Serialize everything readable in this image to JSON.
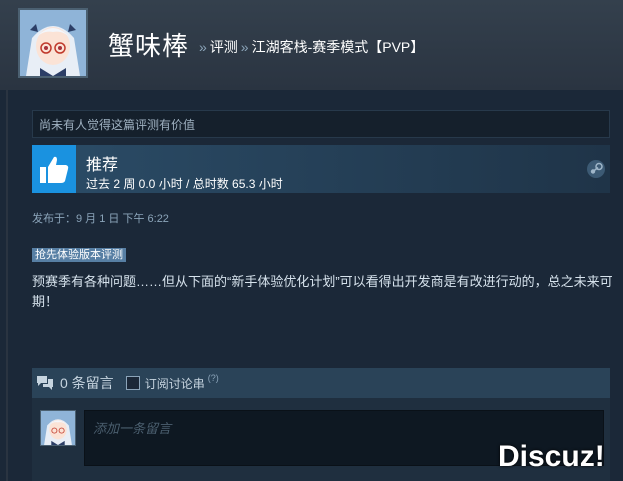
{
  "user": {
    "name": "蟹味棒"
  },
  "breadcrumb": {
    "sep": "»",
    "reviews": "评测",
    "game": "江湖客栈-赛季模式【PVP】"
  },
  "review": {
    "helpful_text": "尚未有人觉得这篇评测有价值",
    "recommend_label": "推荐",
    "hours_text": "过去 2 周 0.0 小时 / 总时数 65.3 小时",
    "posted": "发布于：9 月 1 日 下午 6:22",
    "early_access_badge": "抢先体验版本评测",
    "body": "预赛季有各种问题……但从下面的“新手体验优化计划”可以看得出开发商是有改进行动的，总之未来可期！"
  },
  "comments": {
    "count_text": "0 条留言",
    "subscribe_label": "订阅讨论串",
    "help_mark": "(?)",
    "input_placeholder": "添加一条留言"
  },
  "watermark": "Discuz!",
  "colors": {
    "background": "#1b2838",
    "thumb_blue": "#1a92e0",
    "badge": "#577fa4"
  },
  "icons": {
    "recommend": "thumbs-up-icon",
    "platform": "steam-icon",
    "comments": "speech-bubbles-icon"
  }
}
